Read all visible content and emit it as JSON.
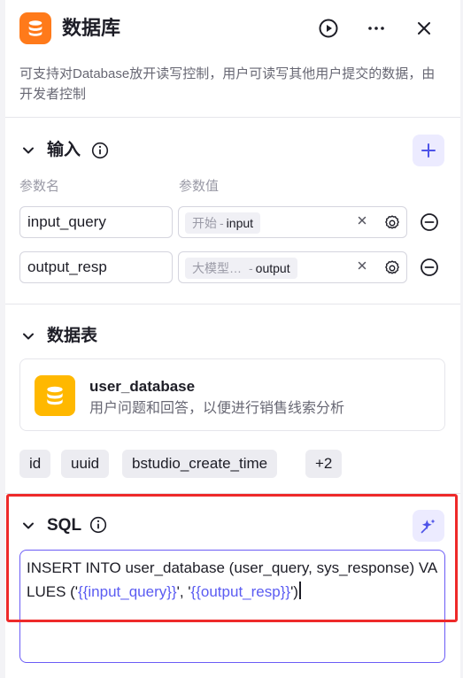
{
  "header": {
    "title": "数据库",
    "description": "可支持对Database放开读写控制，用户可读写其他用户提交的数据，由开发者控制",
    "icon": "database-icon",
    "accent": "#ff7a1a"
  },
  "input_section": {
    "title": "输入",
    "col_name_label": "参数名",
    "col_value_label": "参数值",
    "params": [
      {
        "name": "input_query",
        "source": "开始",
        "separator": "-",
        "variable": "input"
      },
      {
        "name": "output_resp",
        "source": "大模型…",
        "separator": "-",
        "variable": "output"
      }
    ]
  },
  "table_section": {
    "title": "数据表",
    "table": {
      "name": "user_database",
      "description": "用户问题和回答，以便进行销售线索分析",
      "icon_color": "#ffb800"
    },
    "fields": [
      "id",
      "uuid",
      "bstudio_create_time",
      "+2"
    ]
  },
  "sql_section": {
    "title": "SQL",
    "sql": {
      "prefix": "INSERT INTO user_database (user_query, sys_response) VALUES ('",
      "var1": "{{input_query}}",
      "mid": "', '",
      "var2": "{{output_resp}}",
      "suffix": "')"
    },
    "highlight_color": "#ee2a2a",
    "editor_border": "#6b5cf6"
  }
}
